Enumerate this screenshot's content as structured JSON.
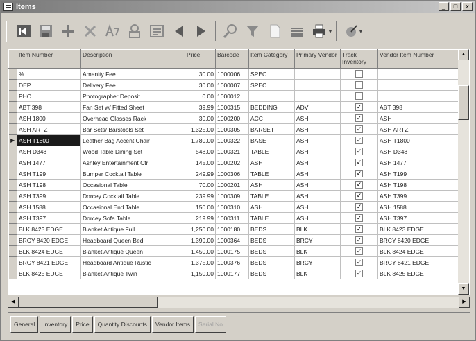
{
  "window": {
    "title": "Items",
    "controls": [
      "_",
      "□",
      "x"
    ]
  },
  "toolbar": {
    "buttons": [
      "first-record-icon",
      "save-icon",
      "add-icon",
      "delete-icon",
      "find-replace-icon",
      "print-preview-icon",
      "list-icon",
      "previous-icon",
      "next-icon",
      "search-icon",
      "filter-icon",
      "new-document-icon",
      "form-icon",
      "printer-icon",
      "export-icon"
    ]
  },
  "grid": {
    "columns": [
      "Item Number",
      "Description",
      "Price",
      "Barcode",
      "Item Category",
      "Primary Vendor",
      "Track Inventory",
      "Vendor Item Number"
    ],
    "rows": [
      [
        "%",
        "Amenity Fee",
        "30.00",
        "1000006",
        "SPEC",
        "",
        false,
        ""
      ],
      [
        "DEP",
        "Delivery Fee",
        "30.00",
        "1000007",
        "SPEC",
        "",
        false,
        ""
      ],
      [
        "PHC",
        "Photographer Deposit",
        "0.00",
        "1000012",
        "",
        "",
        false,
        ""
      ],
      [
        "ABT 398",
        "Fan Set w/ Fitted Sheet",
        "39.99",
        "1000315",
        "BEDDING",
        "ADV",
        true,
        "ABT 398"
      ],
      [
        "ASH 1800",
        "Overhead Glasses Rack",
        "30.00",
        "1000200",
        "ACC",
        "ASH",
        true,
        "ASH"
      ],
      [
        "ASH ARTZ",
        "Bar Sets/ Barstools Set",
        "1,325.00",
        "1000305",
        "BARSET",
        "ASH",
        true,
        "ASH ARTZ"
      ],
      [
        "ASH T1800",
        "Leather Bag Accent Chair",
        "1,780.00",
        "1000322",
        "BASE",
        "ASH",
        true,
        "ASH T1800"
      ],
      [
        "ASH D348",
        "Wood Table Dining Set",
        "548.00",
        "1000321",
        "TABLE",
        "ASH",
        true,
        "ASH D348"
      ],
      [
        "ASH 1477",
        "Ashley Entertainment Ctr",
        "145.00",
        "1000202",
        "ASH",
        "ASH",
        true,
        "ASH 1477"
      ],
      [
        "ASH T199",
        "Bumper Cocktail Table",
        "249.99",
        "1000306",
        "TABLE",
        "ASH",
        true,
        "ASH T199"
      ],
      [
        "ASH T198",
        "Occasional Table",
        "70.00",
        "1000201",
        "ASH",
        "ASH",
        true,
        "ASH T198"
      ],
      [
        "ASH T399",
        "Dorcey Cocktail Table",
        "239.99",
        "1000309",
        "TABLE",
        "ASH",
        true,
        "ASH T399"
      ],
      [
        "ASH 1588",
        "Occasional End Table",
        "150.00",
        "1000310",
        "ASH",
        "ASH",
        true,
        "ASH 1588"
      ],
      [
        "ASH T397",
        "Dorcey Sofa Table",
        "219.99",
        "1000311",
        "TABLE",
        "ASH",
        true,
        "ASH T397"
      ],
      [
        "BLK 8423 EDGE",
        "Blanket Antique Full",
        "1,250.00",
        "1000180",
        "BEDS",
        "BLK",
        true,
        "BLK 8423 EDGE"
      ],
      [
        "BRCY 8420 EDGE",
        "Headboard Queen Bed",
        "1,399.00",
        "1000364",
        "BEDS",
        "BRCY",
        true,
        "BRCY 8420 EDGE"
      ],
      [
        "BLK 8424 EDGE",
        "Blanket Antique Queen",
        "1,450.00",
        "1000175",
        "BEDS",
        "BLK",
        true,
        "BLK 8424 EDGE"
      ],
      [
        "BRCY 8421 EDGE",
        "Headboard Antique Rustic",
        "1,375.00",
        "1000376",
        "BEDS",
        "BRCY",
        true,
        "BRCY 8421 EDGE"
      ],
      [
        "BLK 8425 EDGE",
        "Blanket Antique Twin",
        "1,150.00",
        "1000177",
        "BEDS",
        "BLK",
        true,
        "BLK 8425 EDGE"
      ]
    ],
    "current_row": 6,
    "current_row_marker": "▶"
  },
  "tabs": [
    {
      "label": "General",
      "disabled": false
    },
    {
      "label": "Inventory",
      "disabled": false
    },
    {
      "label": "Price",
      "disabled": false
    },
    {
      "label": "Quantity Discounts",
      "disabled": false
    },
    {
      "label": "Vendor Items",
      "disabled": false
    },
    {
      "label": "Serial No",
      "disabled": true
    }
  ],
  "colors": {
    "chrome": "#d4d0c8",
    "title_start": "#7a7a7a",
    "title_end": "#c8c8c8",
    "selection": "#1a1a1a"
  }
}
